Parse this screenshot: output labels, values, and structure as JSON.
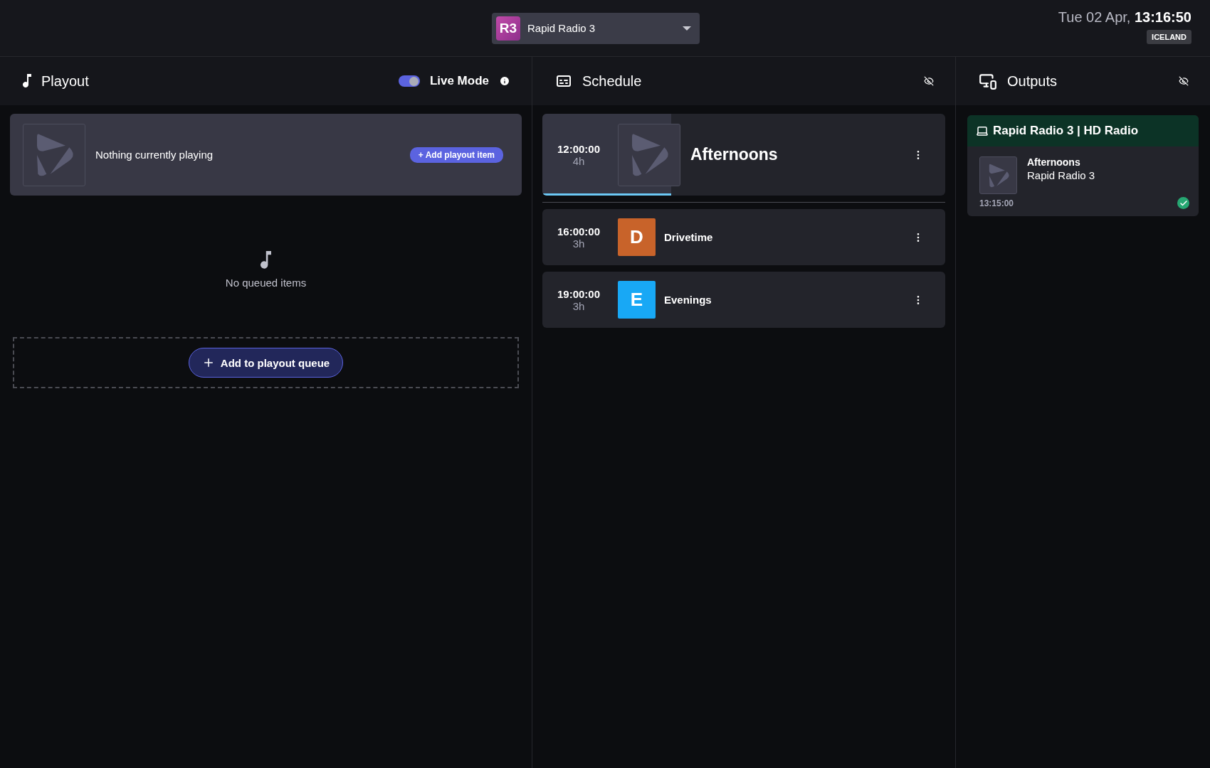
{
  "station_select": {
    "badge": "R3",
    "name": "Rapid Radio 3"
  },
  "clock": {
    "date": "Tue 02 Apr,",
    "time": "13:16:50",
    "timezone": "ICELAND"
  },
  "playout": {
    "title": "Playout",
    "live_mode": {
      "label": "Live Mode",
      "on": true
    },
    "now_playing": {
      "text": "Nothing currently playing",
      "button": "+ Add playout item"
    },
    "queue": {
      "empty_text": "No queued items",
      "button": "Add to playout queue"
    }
  },
  "schedule": {
    "title": "Schedule",
    "items": [
      {
        "kind": "current",
        "time": "12:00:00",
        "duration": "4h",
        "title": "Afternoons",
        "level": 0.32
      },
      {
        "kind": "upcoming",
        "time": "16:00:00",
        "duration": "3h",
        "title": "Drivetime",
        "letter": "D",
        "color": "#c8632a"
      },
      {
        "kind": "upcoming",
        "time": "19:00:00",
        "duration": "3h",
        "title": "Evenings",
        "letter": "E",
        "color": "#18a8f5"
      }
    ]
  },
  "outputs": {
    "title": "Outputs",
    "cards": [
      {
        "name": "Rapid Radio 3 | HD Radio",
        "show": "Afternoons",
        "station": "Rapid Radio 3",
        "time": "13:15:00",
        "ok": true
      }
    ]
  }
}
